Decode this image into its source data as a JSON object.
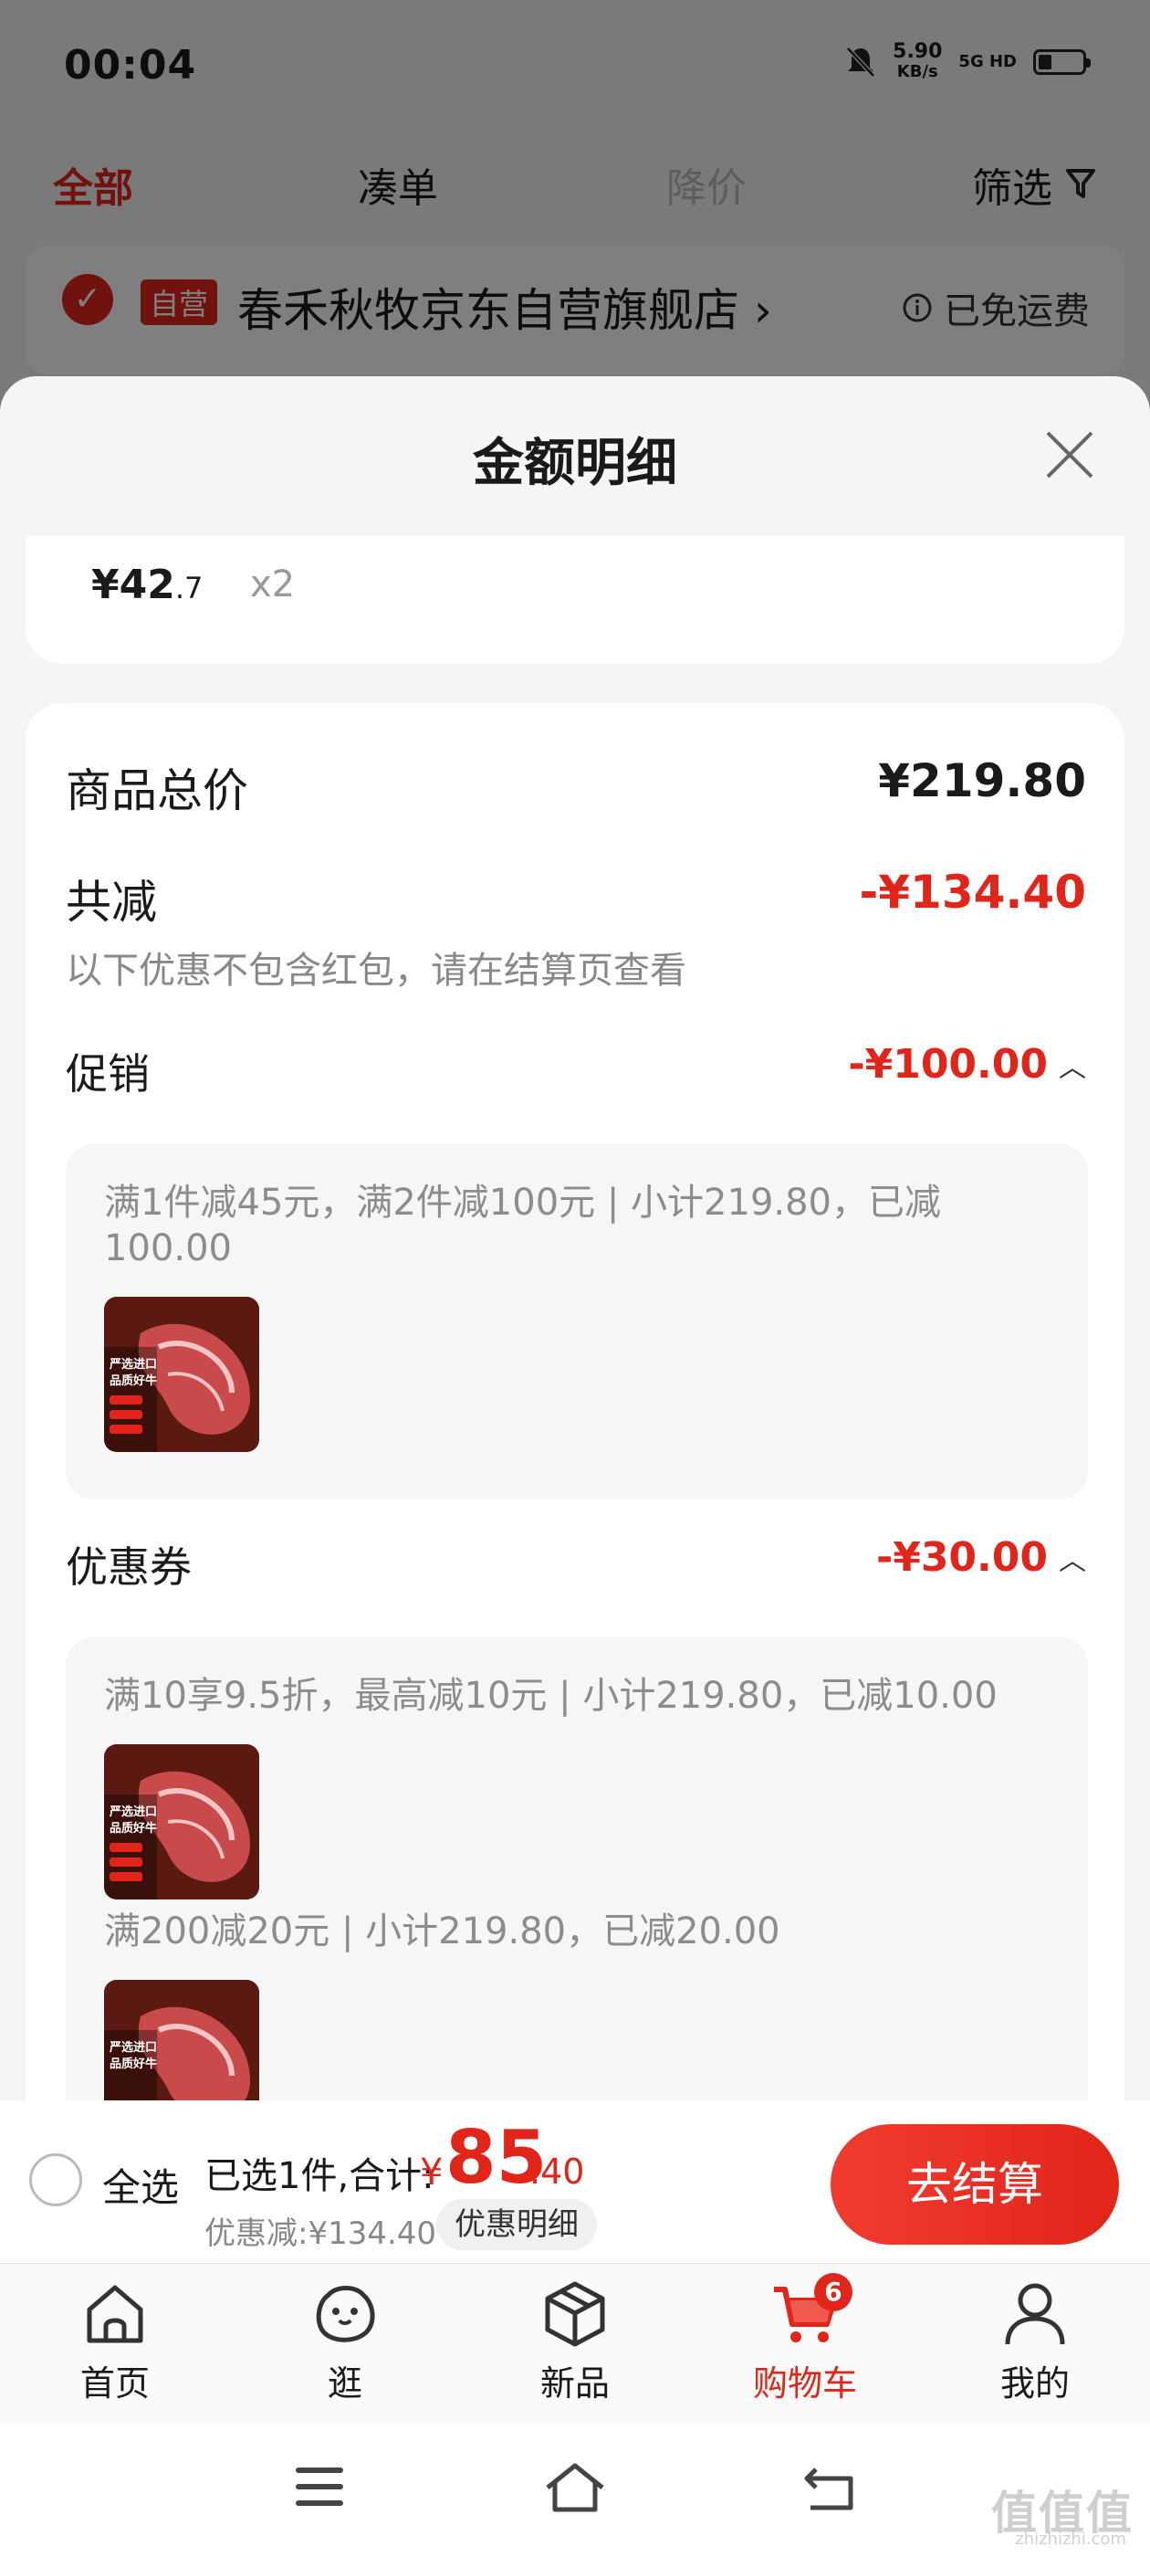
{
  "status_bar": {
    "time": "00:04",
    "speed_value": "5.90",
    "speed_unit": "KB/s",
    "network": "5G HD"
  },
  "filter_tabs": {
    "all": "全部",
    "cou": "凑单",
    "price_drop": "降价",
    "filter": "筛选"
  },
  "shop": {
    "badge": "自营",
    "name": "春禾秋牧京东自营旗舰店",
    "shipping": "已免运费"
  },
  "sheet": {
    "title": "金额明细",
    "product": {
      "price_int": "¥42",
      "price_dec": ".7",
      "qty": "x2"
    },
    "total_label": "商品总价",
    "total_value": "¥219.80",
    "reduce_label": "共减",
    "reduce_value": "-¥134.40",
    "hint": "以下优惠不包含红包，请在结算页查看",
    "promo": {
      "label": "促销",
      "value": "-¥100.00",
      "line1": "满1件减45元，满2件减100元 | 小计219.80，已减",
      "line2": "100.00"
    },
    "coupon": {
      "label": "优惠券",
      "value": "-¥30.00",
      "item1": "满10享9.5折，最高减10元 | 小计219.80，已减10.00",
      "item2": "满200减20元 | 小计219.80，已减20.00"
    },
    "thumb_text": {
      "line1": "严选进口",
      "line2": "品质好牛"
    }
  },
  "checkout": {
    "select_all": "全选",
    "selected": "已选1件,合计:",
    "yen": "¥",
    "total_int": "85",
    "total_dec": ".40",
    "discount": "优惠减:¥134.40",
    "discount_detail": "优惠明细",
    "go": "去结算"
  },
  "tabbar": {
    "home": "首页",
    "browse": "逛",
    "new": "新品",
    "cart": "购物车",
    "cart_badge": "6",
    "mine": "我的"
  },
  "watermark": {
    "main": "值值值",
    "sub": "zhizhizhi.com"
  },
  "colors": {
    "accent": "#e1251b",
    "overlay": "rgba(0,0,0,0.5)"
  }
}
